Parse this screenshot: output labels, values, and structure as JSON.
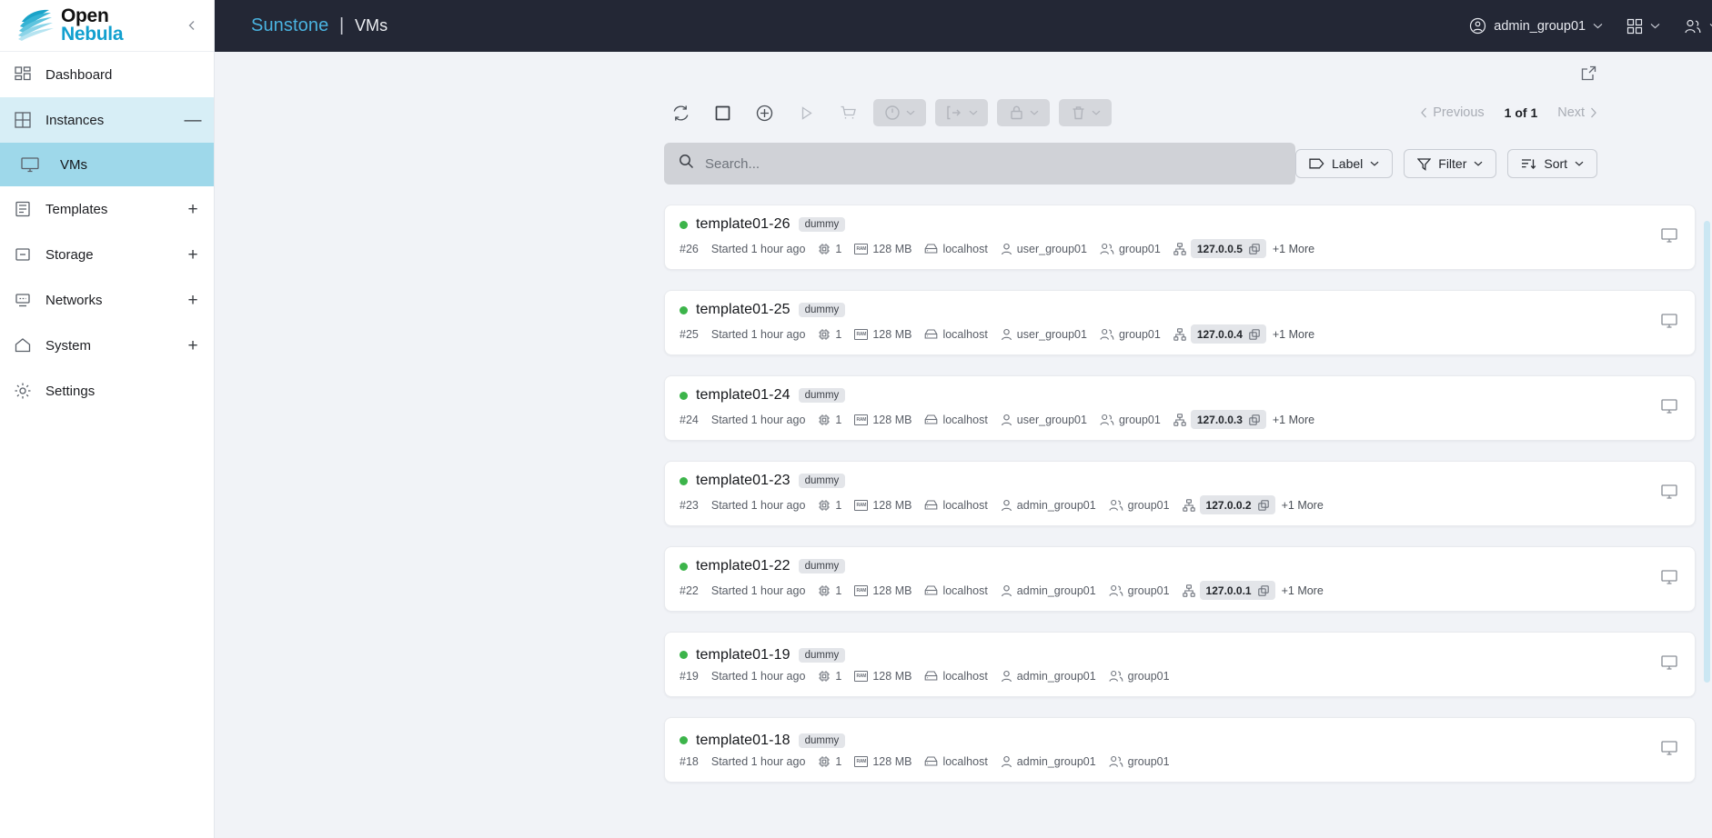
{
  "brand": {
    "line1": "Open",
    "line2": "Nebula",
    "logo_icon": "opennebula-cloud-logo",
    "collapse_icon": "chevron-left-icon"
  },
  "sidebar": {
    "items": [
      {
        "label": "Dashboard",
        "icon": "dashboard-grid-icon",
        "tail": "",
        "state": "default",
        "name": "sidebar-item-dashboard"
      },
      {
        "label": "Instances",
        "icon": "instances-grid-icon",
        "tail": "—",
        "state": "open",
        "name": "sidebar-item-instances"
      },
      {
        "label": "VMs",
        "icon": "monitor-icon",
        "tail": "",
        "state": "active-sub",
        "name": "sidebar-item-vms"
      },
      {
        "label": "Templates",
        "icon": "templates-drawer-icon",
        "tail": "+",
        "state": "default",
        "name": "sidebar-item-templates"
      },
      {
        "label": "Storage",
        "icon": "storage-box-icon",
        "tail": "+",
        "state": "default",
        "name": "sidebar-item-storage"
      },
      {
        "label": "Networks",
        "icon": "network-node-icon",
        "tail": "+",
        "state": "default",
        "name": "sidebar-item-networks"
      },
      {
        "label": "System",
        "icon": "home-icon",
        "tail": "+",
        "state": "default",
        "name": "sidebar-item-system"
      },
      {
        "label": "Settings",
        "icon": "gear-icon",
        "tail": "",
        "state": "default",
        "name": "sidebar-item-settings"
      }
    ]
  },
  "header": {
    "app_name": "Sunstone",
    "separator": "|",
    "page": "VMs",
    "user": {
      "label": "admin_group01",
      "icon": "user-circle-icon",
      "caret": "⌄"
    },
    "apps_menu": {
      "icon": "apps-grid-icon",
      "caret": "⌄"
    },
    "group_menu": {
      "icon": "users-icon",
      "caret": "⌄"
    },
    "language_menu": {
      "icon": "globe-icon",
      "caret": "⌄"
    },
    "accent_color": "#4ab3e0",
    "background_color": "#232735"
  },
  "toolbar": {
    "export_icon": "external-link-icon",
    "buttons": [
      {
        "name": "refresh-button",
        "icon": "refresh-icon",
        "style": "plain"
      },
      {
        "name": "select-all-button",
        "icon": "square-icon",
        "style": "plain"
      },
      {
        "name": "create-vm-button",
        "icon": "plus-circle-icon",
        "style": "plain"
      },
      {
        "name": "play-button",
        "icon": "play-triangle-icon",
        "style": "faint"
      },
      {
        "name": "marketplace-button",
        "icon": "cart-icon",
        "style": "faint"
      },
      {
        "name": "state-actions-dropdown",
        "icon": "power-circle-icon",
        "style": "group"
      },
      {
        "name": "migrate-actions-dropdown",
        "icon": "migrate-arrow-icon",
        "style": "group"
      },
      {
        "name": "lock-actions-dropdown",
        "icon": "lock-icon",
        "style": "group"
      },
      {
        "name": "delete-actions-dropdown",
        "icon": "trash-icon",
        "style": "group"
      }
    ],
    "pagination": {
      "previous": "Previous",
      "count": "1 of 1",
      "next": "Next"
    }
  },
  "search": {
    "placeholder": "Search...",
    "value": "",
    "icon": "search-icon",
    "label_button": {
      "text": "Label",
      "icon": "tag-icon",
      "caret": "⌄"
    },
    "filter_button": {
      "text": "Filter",
      "icon": "funnel-icon",
      "caret": "⌄"
    },
    "sort_button": {
      "text": "Sort",
      "icon": "sort-descending-icon",
      "caret": "⌄"
    }
  },
  "list": {
    "status_color": "#3cb44a",
    "copy_icon": "copy-icon",
    "vnc_icon": "monitor-icon",
    "rows": [
      {
        "name": "template01-26",
        "tag": "dummy",
        "id": "#26",
        "time": "Started 1 hour ago",
        "cpu": "1",
        "memory": "128 MB",
        "host": "localhost",
        "owner": "user_group01",
        "group": "group01",
        "ip": "127.0.0.5",
        "more": "+1 More"
      },
      {
        "name": "template01-25",
        "tag": "dummy",
        "id": "#25",
        "time": "Started 1 hour ago",
        "cpu": "1",
        "memory": "128 MB",
        "host": "localhost",
        "owner": "user_group01",
        "group": "group01",
        "ip": "127.0.0.4",
        "more": "+1 More"
      },
      {
        "name": "template01-24",
        "tag": "dummy",
        "id": "#24",
        "time": "Started 1 hour ago",
        "cpu": "1",
        "memory": "128 MB",
        "host": "localhost",
        "owner": "user_group01",
        "group": "group01",
        "ip": "127.0.0.3",
        "more": "+1 More"
      },
      {
        "name": "template01-23",
        "tag": "dummy",
        "id": "#23",
        "time": "Started 1 hour ago",
        "cpu": "1",
        "memory": "128 MB",
        "host": "localhost",
        "owner": "admin_group01",
        "group": "group01",
        "ip": "127.0.0.2",
        "more": "+1 More"
      },
      {
        "name": "template01-22",
        "tag": "dummy",
        "id": "#22",
        "time": "Started 1 hour ago",
        "cpu": "1",
        "memory": "128 MB",
        "host": "localhost",
        "owner": "admin_group01",
        "group": "group01",
        "ip": "127.0.0.1",
        "more": "+1 More"
      },
      {
        "name": "template01-19",
        "tag": "dummy",
        "id": "#19",
        "time": "Started 1 hour ago",
        "cpu": "1",
        "memory": "128 MB",
        "host": "localhost",
        "owner": "admin_group01",
        "group": "group01",
        "ip": "",
        "more": ""
      },
      {
        "name": "template01-18",
        "tag": "dummy",
        "id": "#18",
        "time": "Started 1 hour ago",
        "cpu": "1",
        "memory": "128 MB",
        "host": "localhost",
        "owner": "admin_group01",
        "group": "group01",
        "ip": "",
        "more": ""
      }
    ]
  }
}
